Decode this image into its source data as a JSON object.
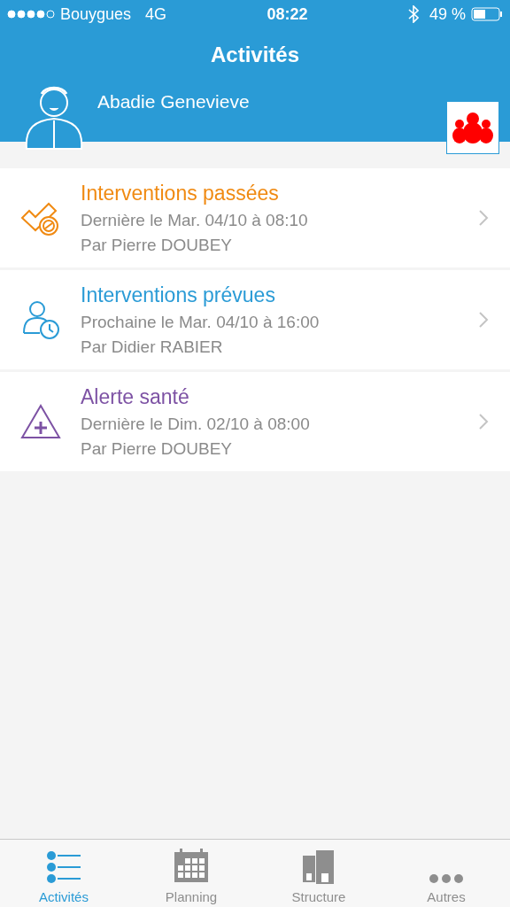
{
  "status_bar": {
    "carrier": "Bouygues",
    "network": "4G",
    "time": "08:22",
    "battery": "49 %"
  },
  "title": "Activités",
  "user": {
    "name": "Abadie Genevieve"
  },
  "activities": [
    {
      "kind": "past",
      "color": "#f08a12",
      "title": "Interventions passées",
      "line1": "Dernière le Mar. 04/10 à 08:10",
      "line2": "Par Pierre DOUBEY"
    },
    {
      "kind": "planned",
      "color": "#2a9bd6",
      "title": "Interventions prévues",
      "line1": "Prochaine le Mar. 04/10 à 16:00",
      "line2": "Par Didier RABIER"
    },
    {
      "kind": "alert",
      "color": "#7d52a4",
      "title": "Alerte santé",
      "line1": "Dernière le Dim. 02/10 à 08:00",
      "line2": "Par Pierre DOUBEY"
    }
  ],
  "tabs": [
    {
      "kind": "list",
      "label": "Activités",
      "selected": true
    },
    {
      "kind": "calendar",
      "label": "Planning",
      "selected": false
    },
    {
      "kind": "buildings",
      "label": "Structure",
      "selected": false
    },
    {
      "kind": "more",
      "label": "Autres",
      "selected": false
    }
  ]
}
